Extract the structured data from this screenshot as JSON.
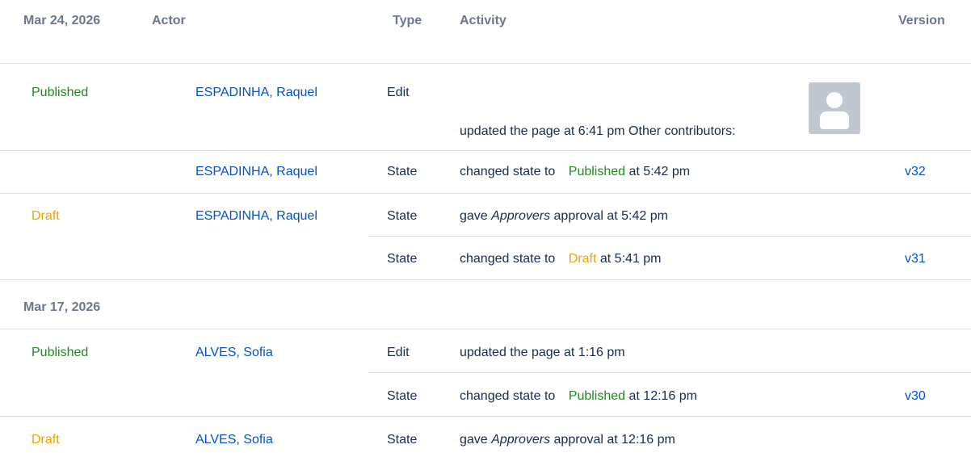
{
  "header": {
    "date": "Mar 24, 2026",
    "actor": "Actor",
    "type": "Type",
    "activity": "Activity",
    "version": "Version"
  },
  "rows": [
    {
      "status": "Published",
      "actor": "ESPADINHA, Raquel",
      "type": "Edit",
      "activity": "updated the page at 6:41 pm Other contributors:"
    },
    {
      "actor": "ESPADINHA, Raquel",
      "type": "State",
      "activity_prefix": "changed state to",
      "activity_state": "Published",
      "activity_suffix": "at 5:42 pm",
      "version": "v32"
    },
    {
      "status": "Draft",
      "actor": "ESPADINHA, Raquel",
      "type": "State",
      "activity_prefix": "gave",
      "activity_em": "Approvers",
      "activity_suffix": "approval at 5:42 pm"
    },
    {
      "type": "State",
      "activity_prefix": "changed state to",
      "activity_state": "Draft",
      "activity_suffix": "at 5:41 pm",
      "version": "v31"
    }
  ],
  "date2": "Mar 17, 2026",
  "rows2": [
    {
      "status": "Published",
      "actor": "ALVES, Sofia",
      "type": "Edit",
      "activity": "updated the page at 1:16 pm"
    },
    {
      "type": "State",
      "activity_prefix": "changed state to",
      "activity_state": "Published",
      "activity_suffix": "at 12:16 pm",
      "version": "v30"
    },
    {
      "status": "Draft",
      "actor": "ALVES, Sofia",
      "type": "State",
      "activity_prefix": "gave",
      "activity_em": "Approvers",
      "activity_suffix": "approval at 12:16 pm"
    }
  ],
  "icons": {
    "avatar": "user-avatar-icon"
  }
}
